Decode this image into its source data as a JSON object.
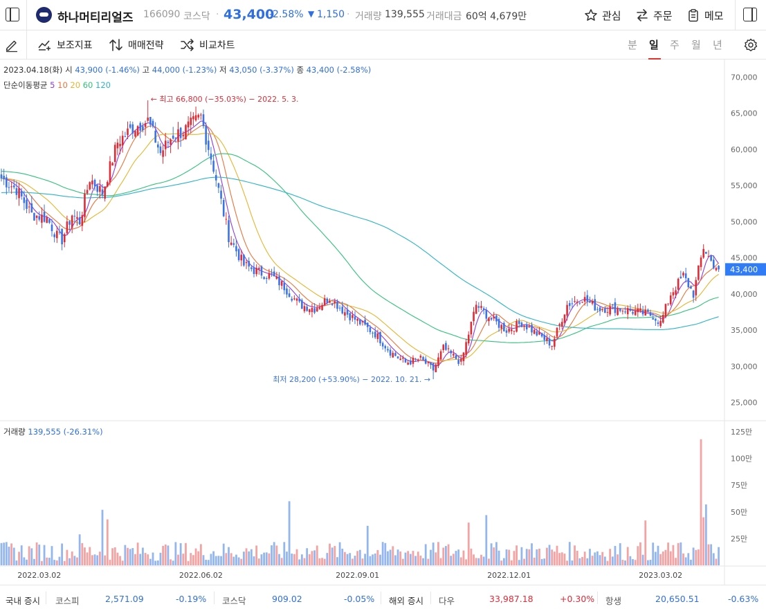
{
  "header": {
    "stock_name": "하나머티리얼즈",
    "stock_code": "166090",
    "market": "코스닥",
    "price": "43,400",
    "change_pct": "-2.58%",
    "change_arrow": "▼",
    "change_amt": "1,150",
    "volume_label": "거래량",
    "volume_value": "139,555",
    "amount_label": "거래대금",
    "amount_value": "60억 4,679만",
    "watch_label": "관심",
    "order_label": "주문",
    "memo_label": "메모",
    "separator": "·"
  },
  "toolbar": {
    "indicator_label": "보조지표",
    "strategy_label": "매매전략",
    "compare_label": "비교차트",
    "periods": [
      "분",
      "일",
      "주",
      "월",
      "년"
    ],
    "active_period": "일"
  },
  "info": {
    "date": "2023.04.18(화)",
    "open_label": "시",
    "open_value": "43,900 (-1.46%)",
    "high_label": "고",
    "high_value": "44,000 (-1.23%)",
    "low_label": "저",
    "low_value": "43,050 (-3.37%)",
    "close_label": "종",
    "close_value": "43,400 (-2.58%)",
    "ma_label": "단순이동평균",
    "ma_periods": [
      "5",
      "10",
      "20",
      "60",
      "120"
    ],
    "volume_label": "거래량",
    "volume_value": "139,555 (-26.31%)"
  },
  "colors": {
    "up": "#e02b36",
    "down": "#3a72e8",
    "vol_up": "#f4a2a2",
    "vol_down": "#93b6ef",
    "ma5": "#8f3ae0",
    "ma10": "#e8743b",
    "ma20": "#e6b52e",
    "ma60": "#2fc27a",
    "ma120": "#2ab3c9",
    "current_price_tag": "#2f7cf6"
  },
  "bottom": {
    "domestic_label": "국내 증시",
    "kospi_label": "코스피",
    "kospi_value": "2,571.09",
    "kospi_change": "-0.19%",
    "kosdaq_label": "코스닥",
    "kosdaq_value": "909.02",
    "kosdaq_change": "-0.05%",
    "overseas_label": "해외 증시",
    "dow_label": "다우",
    "dow_value": "33,987.18",
    "dow_change": "+0.30%",
    "hangseng_label": "항생",
    "hangseng_value": "20,650.51",
    "hangseng_change": "-0.63%"
  },
  "chart_data": {
    "type": "candlestick",
    "price_axis": {
      "min": 25000,
      "max": 70000,
      "ticks": [
        "70,000",
        "65,000",
        "60,000",
        "55,000",
        "50,000",
        "45,000",
        "40,000",
        "35,000",
        "30,000",
        "25,000"
      ],
      "tick_values": [
        70000,
        65000,
        60000,
        55000,
        50000,
        45000,
        40000,
        35000,
        30000,
        25000
      ]
    },
    "volume_axis": {
      "max": 1250000,
      "ticks": [
        "125만",
        "100만",
        "75만",
        "50만",
        "25만"
      ],
      "tick_values": [
        1250000,
        1000000,
        750000,
        500000,
        250000
      ]
    },
    "date_ticks": [
      "2022.03.02",
      "2022.06.02",
      "2022.09.01",
      "2022.12.01",
      "2023.03.02"
    ],
    "date_tick_index": [
      15,
      79,
      141,
      201,
      261
    ],
    "current_price": 43400,
    "current_price_label": "43,400",
    "annotations": {
      "high_label": "최고 66,800 (−35.03%) − 2022. 5. 3.",
      "high_arrow": "←",
      "high_index": 58,
      "high_value": 66800,
      "low_label": "최저 28,200 (+53.90%) − 2022. 10. 21.",
      "low_arrow": "→",
      "low_index": 171,
      "low_value": 28200
    },
    "price_keypoints": [
      [
        0,
        56000
      ],
      [
        6,
        54500
      ],
      [
        12,
        51000
      ],
      [
        18,
        50500
      ],
      [
        22,
        48000
      ],
      [
        24,
        47500
      ],
      [
        28,
        51000
      ],
      [
        31,
        50000
      ],
      [
        35,
        56000
      ],
      [
        40,
        54000
      ],
      [
        46,
        61000
      ],
      [
        52,
        63000
      ],
      [
        58,
        64000
      ],
      [
        63,
        59500
      ],
      [
        68,
        62000
      ],
      [
        72,
        62500
      ],
      [
        79,
        64500
      ],
      [
        84,
        57500
      ],
      [
        90,
        48000
      ],
      [
        96,
        44000
      ],
      [
        102,
        43000
      ],
      [
        107,
        42500
      ],
      [
        112,
        41000
      ],
      [
        118,
        38500
      ],
      [
        124,
        38000
      ],
      [
        130,
        39500
      ],
      [
        136,
        37500
      ],
      [
        142,
        36000
      ],
      [
        148,
        34500
      ],
      [
        154,
        32000
      ],
      [
        160,
        30500
      ],
      [
        166,
        31000
      ],
      [
        171,
        29500
      ],
      [
        175,
        32500
      ],
      [
        182,
        30500
      ],
      [
        188,
        38500
      ],
      [
        194,
        36500
      ],
      [
        200,
        35000
      ],
      [
        206,
        36000
      ],
      [
        212,
        34500
      ],
      [
        218,
        33000
      ],
      [
        224,
        38500
      ],
      [
        230,
        39500
      ],
      [
        236,
        38000
      ],
      [
        244,
        38000
      ],
      [
        252,
        37500
      ],
      [
        258,
        37000
      ],
      [
        261,
        36000
      ],
      [
        265,
        40000
      ],
      [
        270,
        42500
      ],
      [
        274,
        40000
      ],
      [
        278,
        46500
      ],
      [
        281,
        44500
      ],
      [
        284,
        43400
      ]
    ],
    "volume_spikes": [
      [
        31,
        290000
      ],
      [
        40,
        520000
      ],
      [
        42,
        430000
      ],
      [
        114,
        600000
      ],
      [
        145,
        370000
      ],
      [
        185,
        400000
      ],
      [
        192,
        470000
      ],
      [
        255,
        420000
      ],
      [
        277,
        1180000
      ],
      [
        278,
        450000
      ],
      [
        279,
        570000
      ]
    ],
    "ma_periods": [
      5,
      10,
      20,
      60,
      120
    ],
    "series_count": 285
  }
}
